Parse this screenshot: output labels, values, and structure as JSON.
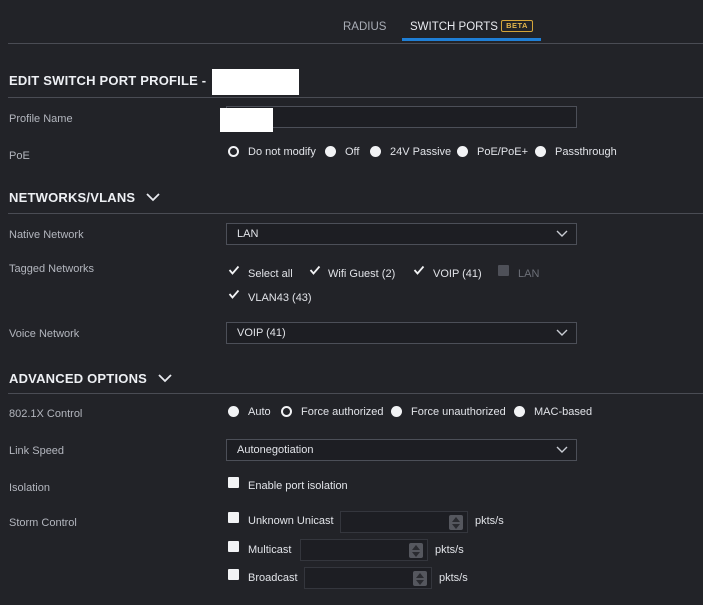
{
  "tabs": [
    {
      "label": "RADIUS"
    },
    {
      "label": "SWITCH PORTS",
      "badge": "BETA",
      "active": true
    }
  ],
  "page_title": "EDIT SWITCH PORT PROFILE -",
  "profile_name": {
    "label": "Profile Name",
    "value": ""
  },
  "poe": {
    "label": "PoE",
    "options": [
      "Do not modify",
      "Off",
      "24V Passive",
      "PoE/PoE+",
      "Passthrough"
    ],
    "selected": "Do not modify"
  },
  "networks_section": {
    "title": "NETWORKS/VLANS"
  },
  "native_network": {
    "label": "Native Network",
    "value": "LAN"
  },
  "tagged_networks": {
    "label": "Tagged Networks",
    "options": [
      {
        "label": "Select all",
        "checked": true
      },
      {
        "label": "Wifi Guest (2)",
        "checked": true
      },
      {
        "label": "VOIP (41)",
        "checked": true
      },
      {
        "label": "LAN",
        "checked": false,
        "disabled": true
      },
      {
        "label": "VLAN43 (43)",
        "checked": true
      }
    ]
  },
  "voice_network": {
    "label": "Voice Network",
    "value": "VOIP (41)"
  },
  "advanced_section": {
    "title": "ADVANCED OPTIONS"
  },
  "dot1x": {
    "label": "802.1X Control",
    "options": [
      "Auto",
      "Force authorized",
      "Force unauthorized",
      "MAC-based"
    ],
    "selected": "Force authorized"
  },
  "link_speed": {
    "label": "Link Speed",
    "value": "Autonegotiation"
  },
  "isolation": {
    "label": "Isolation",
    "option": "Enable port isolation",
    "checked": false
  },
  "storm_control": {
    "label": "Storm Control",
    "unit": "pkts/s",
    "rows": [
      {
        "label": "Unknown Unicast",
        "checked": false
      },
      {
        "label": "Multicast",
        "checked": false
      },
      {
        "label": "Broadcast",
        "checked": false
      }
    ]
  },
  "colors": {
    "accent": "#1f7fd6",
    "beta": "#e3b54b",
    "background": "#222328"
  }
}
